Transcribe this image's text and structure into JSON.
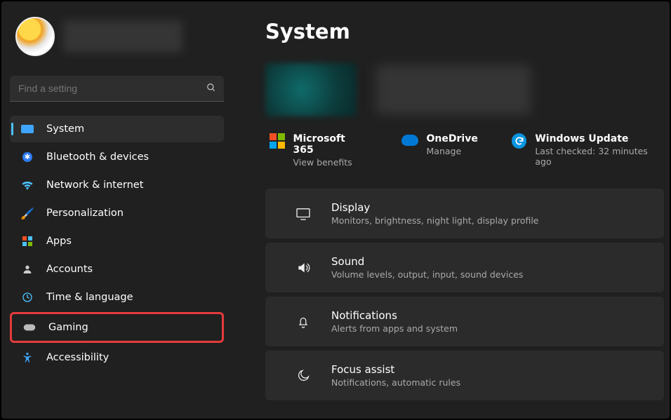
{
  "search": {
    "placeholder": "Find a setting"
  },
  "nav": {
    "items": [
      {
        "label": "System"
      },
      {
        "label": "Bluetooth & devices"
      },
      {
        "label": "Network & internet"
      },
      {
        "label": "Personalization"
      },
      {
        "label": "Apps"
      },
      {
        "label": "Accounts"
      },
      {
        "label": "Time & language"
      },
      {
        "label": "Gaming"
      },
      {
        "label": "Accessibility"
      }
    ]
  },
  "page": {
    "title": "System"
  },
  "quick": {
    "ms365": {
      "title": "Microsoft 365",
      "sub": "View benefits"
    },
    "onedrive": {
      "title": "OneDrive",
      "sub": "Manage"
    },
    "update": {
      "title": "Windows Update",
      "sub": "Last checked: 32 minutes ago"
    }
  },
  "cards": {
    "display": {
      "title": "Display",
      "sub": "Monitors, brightness, night light, display profile"
    },
    "sound": {
      "title": "Sound",
      "sub": "Volume levels, output, input, sound devices"
    },
    "notifications": {
      "title": "Notifications",
      "sub": "Alerts from apps and system"
    },
    "focus": {
      "title": "Focus assist",
      "sub": "Notifications, automatic rules"
    }
  }
}
